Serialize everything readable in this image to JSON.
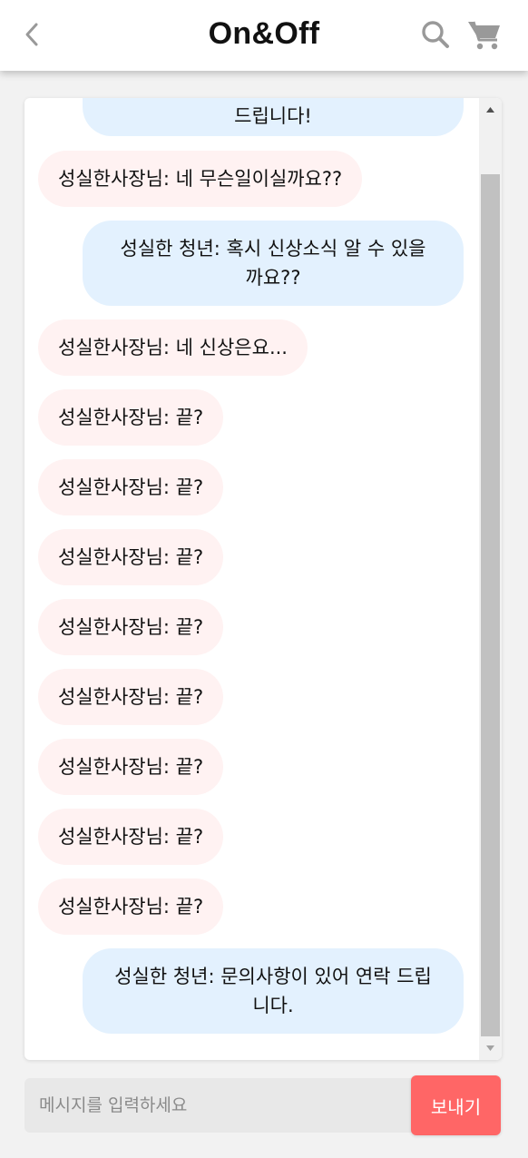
{
  "header": {
    "title": "On&Off",
    "back_icon": "chevron-left-icon",
    "search_icon": "search-icon",
    "cart_icon": "cart-icon"
  },
  "messages": [
    {
      "sender": "me",
      "text": "드립니다!"
    },
    {
      "sender": "other",
      "text": "성실한사장님: 네 무슨일이실까요??"
    },
    {
      "sender": "me",
      "text": "성실한 청년: 혹시 신상소식 알 수 있을까요??"
    },
    {
      "sender": "other",
      "text": "성실한사장님: 네 신상은요..."
    },
    {
      "sender": "other",
      "text": "성실한사장님: 끝?"
    },
    {
      "sender": "other",
      "text": "성실한사장님: 끝?"
    },
    {
      "sender": "other",
      "text": "성실한사장님: 끝?"
    },
    {
      "sender": "other",
      "text": "성실한사장님: 끝?"
    },
    {
      "sender": "other",
      "text": "성실한사장님: 끝?"
    },
    {
      "sender": "other",
      "text": "성실한사장님: 끝?"
    },
    {
      "sender": "other",
      "text": "성실한사장님: 끝?"
    },
    {
      "sender": "other",
      "text": "성실한사장님: 끝?"
    },
    {
      "sender": "me",
      "text": "성실한 청년: 문의사항이 있어 연락 드립니다."
    }
  ],
  "composer": {
    "placeholder": "메시지를 입력하세요",
    "send_label": "보내기"
  },
  "colors": {
    "my_bubble": "#e3f1fe",
    "other_bubble": "#fff2f2",
    "send_button": "#ff6666"
  }
}
